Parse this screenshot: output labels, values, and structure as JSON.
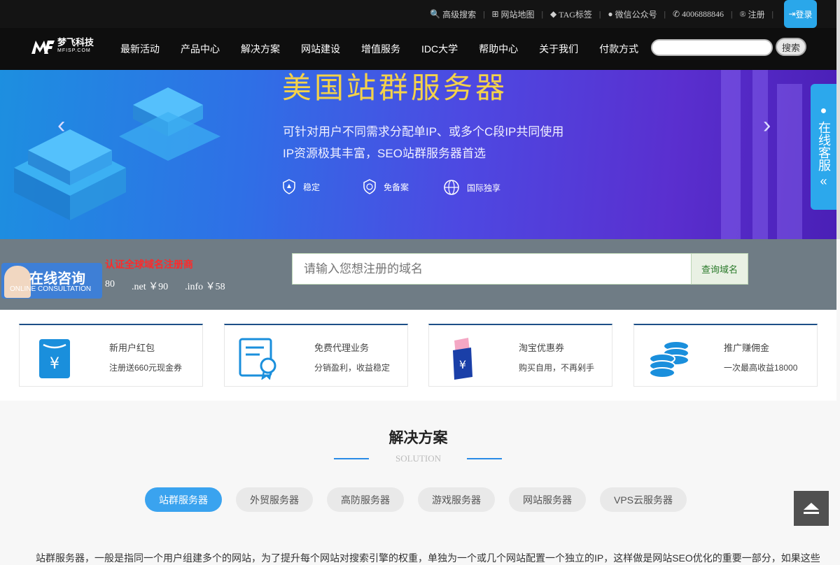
{
  "topbar": {
    "links": [
      {
        "icon": "search-icon",
        "label": "高级搜索"
      },
      {
        "icon": "sitemap-icon",
        "label": "网站地图"
      },
      {
        "icon": "tag-icon",
        "label": "TAG标签"
      },
      {
        "icon": "wechat-icon",
        "label": "微信公众号"
      },
      {
        "icon": "phone-icon",
        "label": "4006888846"
      },
      {
        "icon": "register-icon",
        "label": "注册"
      }
    ],
    "login_label": "登录"
  },
  "nav": {
    "logo_text": "梦飞科技",
    "logo_sub": "MFISP.COM",
    "items": [
      "最新活动",
      "产品中心",
      "解决方案",
      "网站建设",
      "增值服务",
      "IDC大学",
      "帮助中心",
      "关于我们",
      "付款方式"
    ],
    "search_value": "",
    "search_button": "搜索"
  },
  "banner": {
    "title": "美国站群服务器",
    "line1": "可针对用户不同需求分配单IP、或多个C段IP共同使用",
    "line2": "IP资源极其丰富，SEO站群服务器首选",
    "features": [
      "稳定",
      "免备案",
      "国际独享"
    ]
  },
  "side_chat": {
    "label": "在线客服"
  },
  "domain": {
    "hint": "认证全球域名注册商",
    "prices": [
      "80",
      ".net ￥90",
      ".info ￥58"
    ],
    "placeholder": "请输入您想注册的域名",
    "button": "查询域名"
  },
  "consult": {
    "title": "在线咨询",
    "subtitle": "ONLINE CONSULTATION"
  },
  "cards": [
    {
      "icon": "red-packet-icon",
      "title": "新用户红包",
      "desc": "注册送660元现金券"
    },
    {
      "icon": "certificate-icon",
      "title": "免费代理业务",
      "desc": "分销盈利，收益稳定"
    },
    {
      "icon": "coupon-icon",
      "title": "淘宝优惠券",
      "desc": "购买自用，不再剁手"
    },
    {
      "icon": "coins-icon",
      "title": "推广赚佣金",
      "desc": "一次最高收益18000"
    }
  ],
  "solution": {
    "title": "解决方案",
    "subtitle": "SOLUTION",
    "tabs": [
      "站群服务器",
      "外贸服务器",
      "高防服务器",
      "游戏服务器",
      "网站服务器",
      "VPS云服务器"
    ],
    "active_tab": "站群服务器",
    "paragraph": "站群服务器，一般是指同一个用户组建多个的网站，为了提升每个网站对搜索引擎的权重，单独为一个或几个网站配置一个独立的IP，这样做是网站SEO优化的重要一部分，如果这些"
  },
  "colors": {
    "accent": "#3aa3ef",
    "topbar": "#141414",
    "domain_bg": "#6f7c85",
    "hint_red": "#ff2a2a",
    "banner_title": "#f4d24a"
  }
}
